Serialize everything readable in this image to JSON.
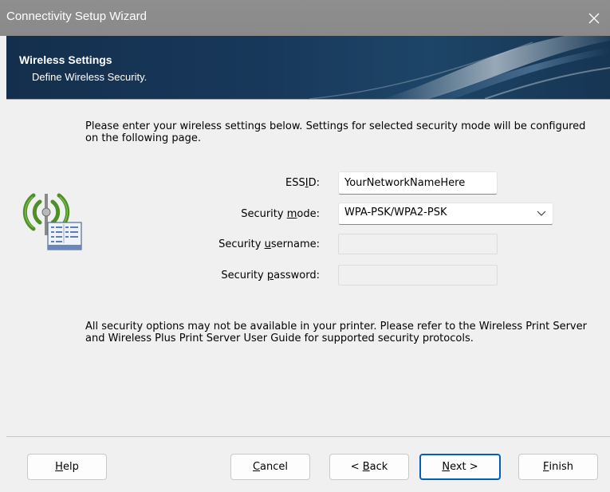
{
  "window": {
    "title": "Connectivity Setup Wizard"
  },
  "banner": {
    "title": "Wireless Settings",
    "subtitle": "Define Wireless Security."
  },
  "content": {
    "intro": "Please enter your wireless settings below. Settings for selected security mode will be configured on the following page.",
    "note": "All security options may not be available in your printer. Please refer to the Wireless Print Server and Wireless Plus Print Server User Guide for supported security protocols."
  },
  "form": {
    "essid": {
      "label_pre": "ESS",
      "label_ul": "I",
      "label_post": "D:",
      "value": "YourNetworkNameHere"
    },
    "security_mode": {
      "label_pre": "Security ",
      "label_ul": "m",
      "label_post": "ode:",
      "value": "WPA-PSK/WPA2-PSK"
    },
    "security_username": {
      "label_pre": "Security ",
      "label_ul": "u",
      "label_post": "sername:",
      "value": ""
    },
    "security_password": {
      "label_pre": "Security ",
      "label_ul": "p",
      "label_post": "assword:",
      "value": ""
    }
  },
  "buttons": {
    "help": {
      "ul": "H",
      "rest": "elp"
    },
    "cancel": {
      "ul": "C",
      "rest": "ancel"
    },
    "back": {
      "pre": "< ",
      "ul": "B",
      "rest": "ack"
    },
    "next": {
      "ul": "N",
      "rest": "ext >"
    },
    "finish": {
      "ul": "F",
      "rest": "inish"
    }
  },
  "icons": {
    "close": "close-icon",
    "wireless": "wireless-printer-icon",
    "dropdown": "chevron-down-icon"
  },
  "colors": {
    "titlebar": "#8c8c8c",
    "banner": "#18395c",
    "accent": "#005fb8",
    "wifi_green": "#4f8f2a"
  }
}
